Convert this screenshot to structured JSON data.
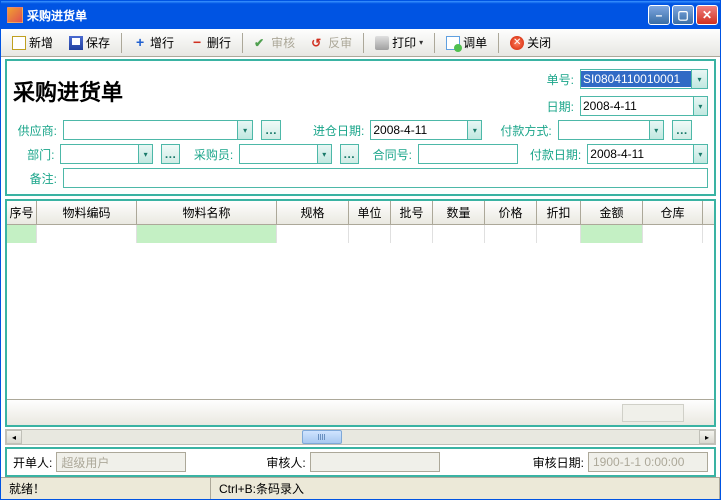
{
  "window": {
    "title": "采购进货单"
  },
  "toolbar": {
    "new": "新增",
    "save": "保存",
    "addRow": "增行",
    "delRow": "删行",
    "approve": "审核",
    "unapprove": "反审",
    "print": "打印",
    "adjust": "调单",
    "close": "关闭"
  },
  "doc": {
    "title": "采购进货单",
    "number_label": "单号:",
    "number": "SI0804110010001",
    "date_label": "日期:",
    "date": "2008-4-11",
    "supplier_label": "供应商:",
    "supplier": "",
    "in_date_label": "进仓日期:",
    "in_date": "2008-4-11",
    "pay_method_label": "付款方式:",
    "pay_method": "",
    "dept_label": "部门:",
    "dept": "",
    "buyer_label": "采购员:",
    "buyer": "",
    "contract_label": "合同号:",
    "contract": "",
    "pay_date_label": "付款日期:",
    "pay_date": "2008-4-11",
    "remark_label": "备注:",
    "remark": ""
  },
  "grid": {
    "cols": [
      "序号",
      "物料编码",
      "物料名称",
      "规格",
      "单位",
      "批号",
      "数量",
      "价格",
      "折扣",
      "金额",
      "仓库"
    ]
  },
  "footer": {
    "creator_label": "开单人:",
    "creator": "超级用户",
    "auditor_label": "审核人:",
    "auditor": "",
    "audit_date_label": "审核日期:",
    "audit_date": "1900-1-1 0:00:00"
  },
  "status": {
    "ready": "就绪！",
    "hint": "Ctrl+B:条码录入"
  }
}
